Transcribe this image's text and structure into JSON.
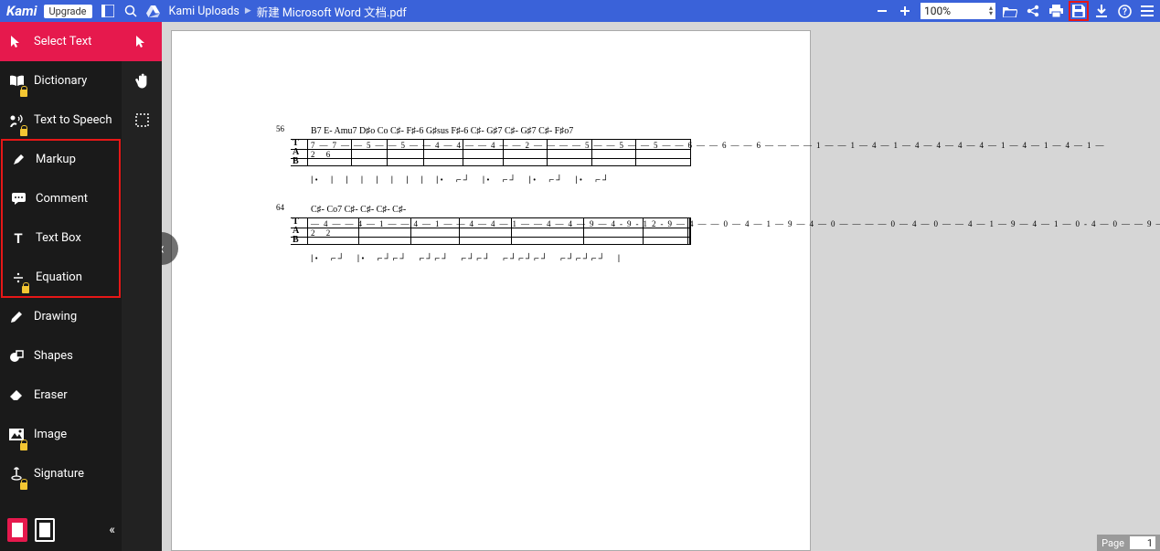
{
  "header": {
    "brand": "Kami",
    "upgrade": "Upgrade",
    "breadcrumb_root": "Kami Uploads",
    "file_name": "新建 Microsoft Word 文档.pdf",
    "zoom": "100%"
  },
  "sidebar": {
    "items": [
      {
        "label": "Select Text",
        "icon": "cursor-select-icon",
        "locked": false,
        "active": true
      },
      {
        "label": "Dictionary",
        "icon": "book-icon",
        "locked": true
      },
      {
        "label": "Text to Speech",
        "icon": "tts-icon",
        "locked": true
      },
      {
        "label": "Markup",
        "icon": "highlighter-icon",
        "locked": false,
        "group_start": true
      },
      {
        "label": "Comment",
        "icon": "comment-icon",
        "locked": false
      },
      {
        "label": "Text Box",
        "icon": "text-icon",
        "locked": false
      },
      {
        "label": "Equation",
        "icon": "equation-icon",
        "locked": true,
        "group_end": true
      },
      {
        "label": "Drawing",
        "icon": "pencil-icon",
        "locked": false
      },
      {
        "label": "Shapes",
        "icon": "shapes-icon",
        "locked": false
      },
      {
        "label": "Eraser",
        "icon": "eraser-icon",
        "locked": false
      },
      {
        "label": "Image",
        "icon": "image-icon",
        "locked": true
      },
      {
        "label": "Signature",
        "icon": "signature-icon",
        "locked": true
      }
    ]
  },
  "page_footer": {
    "label": "Page",
    "number": "1"
  },
  "doc": {
    "system1": {
      "measure_start": "56",
      "chords": "B7   E-   Amu7 D♯o Co   C♯-    F♯-6    G♯sus F♯-6   C♯-   G♯7   C♯-          G♯7          C♯-          F♯o7",
      "frets": "7—7——5——5——4—4——4——2————5——5——5——6——6——6————1——1—4—1—4—4—4—4—1—4—1—4—1—",
      "line2": "                             2                           6"
    },
    "system2": {
      "measure_start": "64",
      "chords": "C♯-             Co7             C♯-             C♯-             C♯-                              C♯-",
      "frets": "—4——4—1——4—1——4—4—1——4—4—9—4-9-12-9—4——0—4—1—9—4—0————0—4—0——4—1—9—4—1—0-4—0——9—",
      "line2": "                                                                     2                                   2"
    }
  }
}
